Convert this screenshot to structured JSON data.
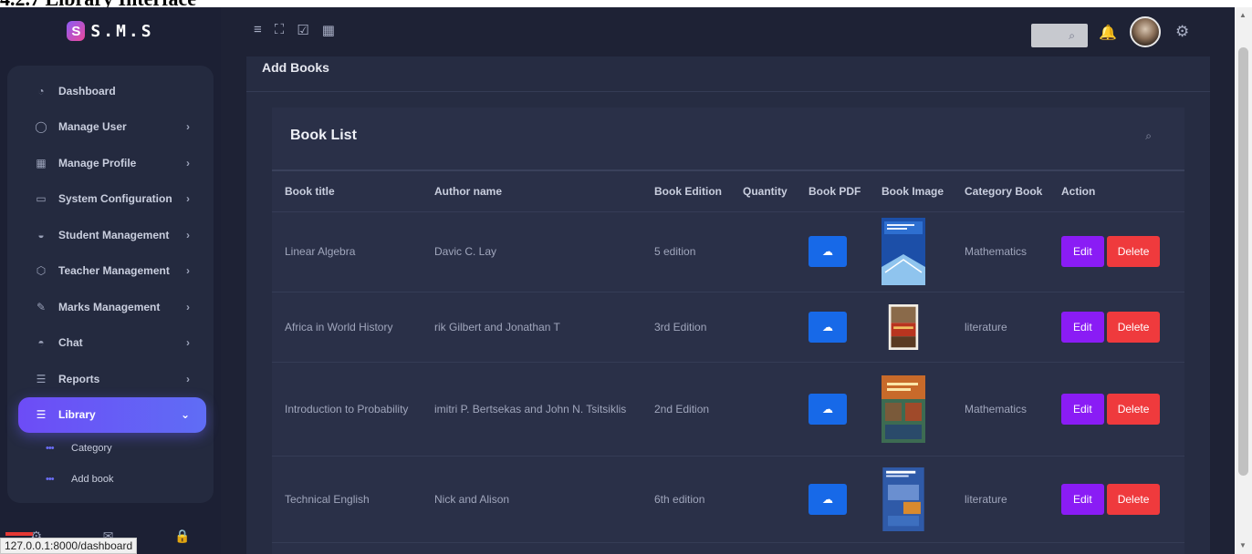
{
  "document": {
    "heading": "4.2.7 Library Interface"
  },
  "app": {
    "logo_mark": "S",
    "logo_text": "S.M.S"
  },
  "topbar": {
    "icons": [
      "menu-icon",
      "expand-icon",
      "checkbox-icon",
      "calendar-icon"
    ],
    "search_icon": "⌕",
    "bell_icon": "🔔",
    "gear_icon": "⚙"
  },
  "sidebar": {
    "items": [
      {
        "label": "Dashboard",
        "icon": "◔",
        "chevron": ""
      },
      {
        "label": "Manage User",
        "icon": "◯",
        "chevron": "›"
      },
      {
        "label": "Manage Profile",
        "icon": "▦",
        "chevron": "›"
      },
      {
        "label": "System Configuration",
        "icon": "▭",
        "chevron": "›"
      },
      {
        "label": "Student Management",
        "icon": "◒",
        "chevron": "›"
      },
      {
        "label": "Teacher Management",
        "icon": "⬡",
        "chevron": "›"
      },
      {
        "label": "Marks Management",
        "icon": "✎",
        "chevron": "›"
      },
      {
        "label": "Chat",
        "icon": "◓",
        "chevron": "›"
      },
      {
        "label": "Reports",
        "icon": "☰",
        "chevron": "›"
      },
      {
        "label": "Library",
        "icon": "☰",
        "chevron": "⌄"
      }
    ],
    "subitems": [
      {
        "label": "Category",
        "dots": "•••"
      },
      {
        "label": "Add book",
        "dots": "•••"
      }
    ],
    "footer_icons": [
      "⚙",
      "✉",
      "🔒"
    ]
  },
  "statusbar": {
    "url": "127.0.0.1:8000/dashboard"
  },
  "main": {
    "page_title": "Add Books",
    "card_title": "Book List",
    "card_search_icon": "⌕",
    "columns": [
      "Book title",
      "Author name",
      "Book Edition",
      "Quantity",
      "Book PDF",
      "Book Image",
      "Category Book",
      "Action"
    ],
    "rows": [
      {
        "title": "Linear Algebra",
        "author": "Davic C. Lay",
        "edition": "5 edition",
        "quantity": "",
        "category": "Mathematics",
        "cover_colors": [
          "#1c4fa8",
          "#8fc4ee"
        ]
      },
      {
        "title": "Africa in World History",
        "author": "rik Gilbert and Jonathan T",
        "edition": "3rd Edition",
        "quantity": "",
        "category": "literature",
        "cover_colors": [
          "#8a3a1c",
          "#c97a3a"
        ]
      },
      {
        "title": "Introduction to Probability",
        "author": "imitri P. Bertsekas and John N. Tsitsiklis",
        "edition": "2nd Edition",
        "quantity": "",
        "category": "Mathematics",
        "cover_colors": [
          "#3d6b52",
          "#c86a2a"
        ]
      },
      {
        "title": "Technical English",
        "author": "Nick and Alison",
        "edition": "6th edition",
        "quantity": "",
        "category": "literature",
        "cover_colors": [
          "#2f5aa8",
          "#d88a2e"
        ]
      }
    ],
    "edit_label": "Edit",
    "delete_label": "Delete",
    "pdf_icon": "☁"
  }
}
